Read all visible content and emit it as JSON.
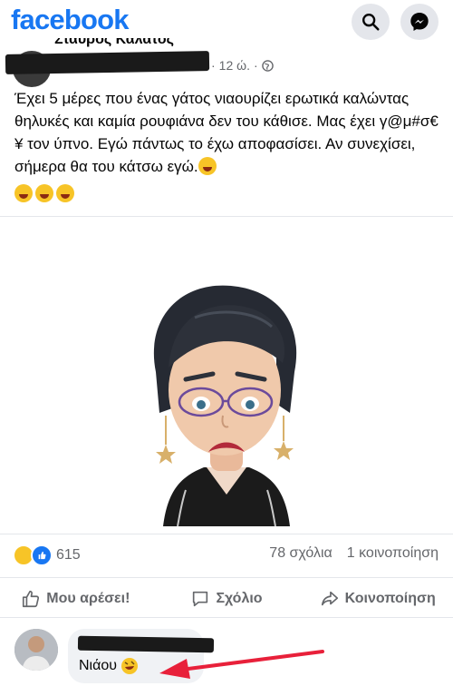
{
  "app": {
    "logo": "facebook"
  },
  "header_icons": [
    "search-icon",
    "messenger-icon"
  ],
  "post": {
    "author_partial": "Σταύρος Καλάτος",
    "time": "12 ώ.",
    "visibility_icon": "globe-icon",
    "text": "Έχει 5 μέρες που ένας γάτος νιαουρίζει ερωτικά καλώντας θηλυκές και καμία ρουφιάνα δεν του κάθισε. Μας έχει γ@μ#σ€¥ τον ύπνο. Εγώ πάντως το έχω αποφασίσει. Αν συνεχίσει, σήμερα θα του κάτσω εγώ."
  },
  "reactions": {
    "count": "615",
    "comments": "78 σχόλια",
    "shares": "1 κοινοποίηση"
  },
  "actions": {
    "like": "Μου αρέσει!",
    "comment": "Σχόλιο",
    "share": "Κοινοποίηση"
  },
  "comment": {
    "text": "Νιάου"
  },
  "colors": {
    "brand": "#1877f2",
    "muted": "#65676b",
    "bubble": "#f0f2f5",
    "arrow": "#e8203a"
  }
}
